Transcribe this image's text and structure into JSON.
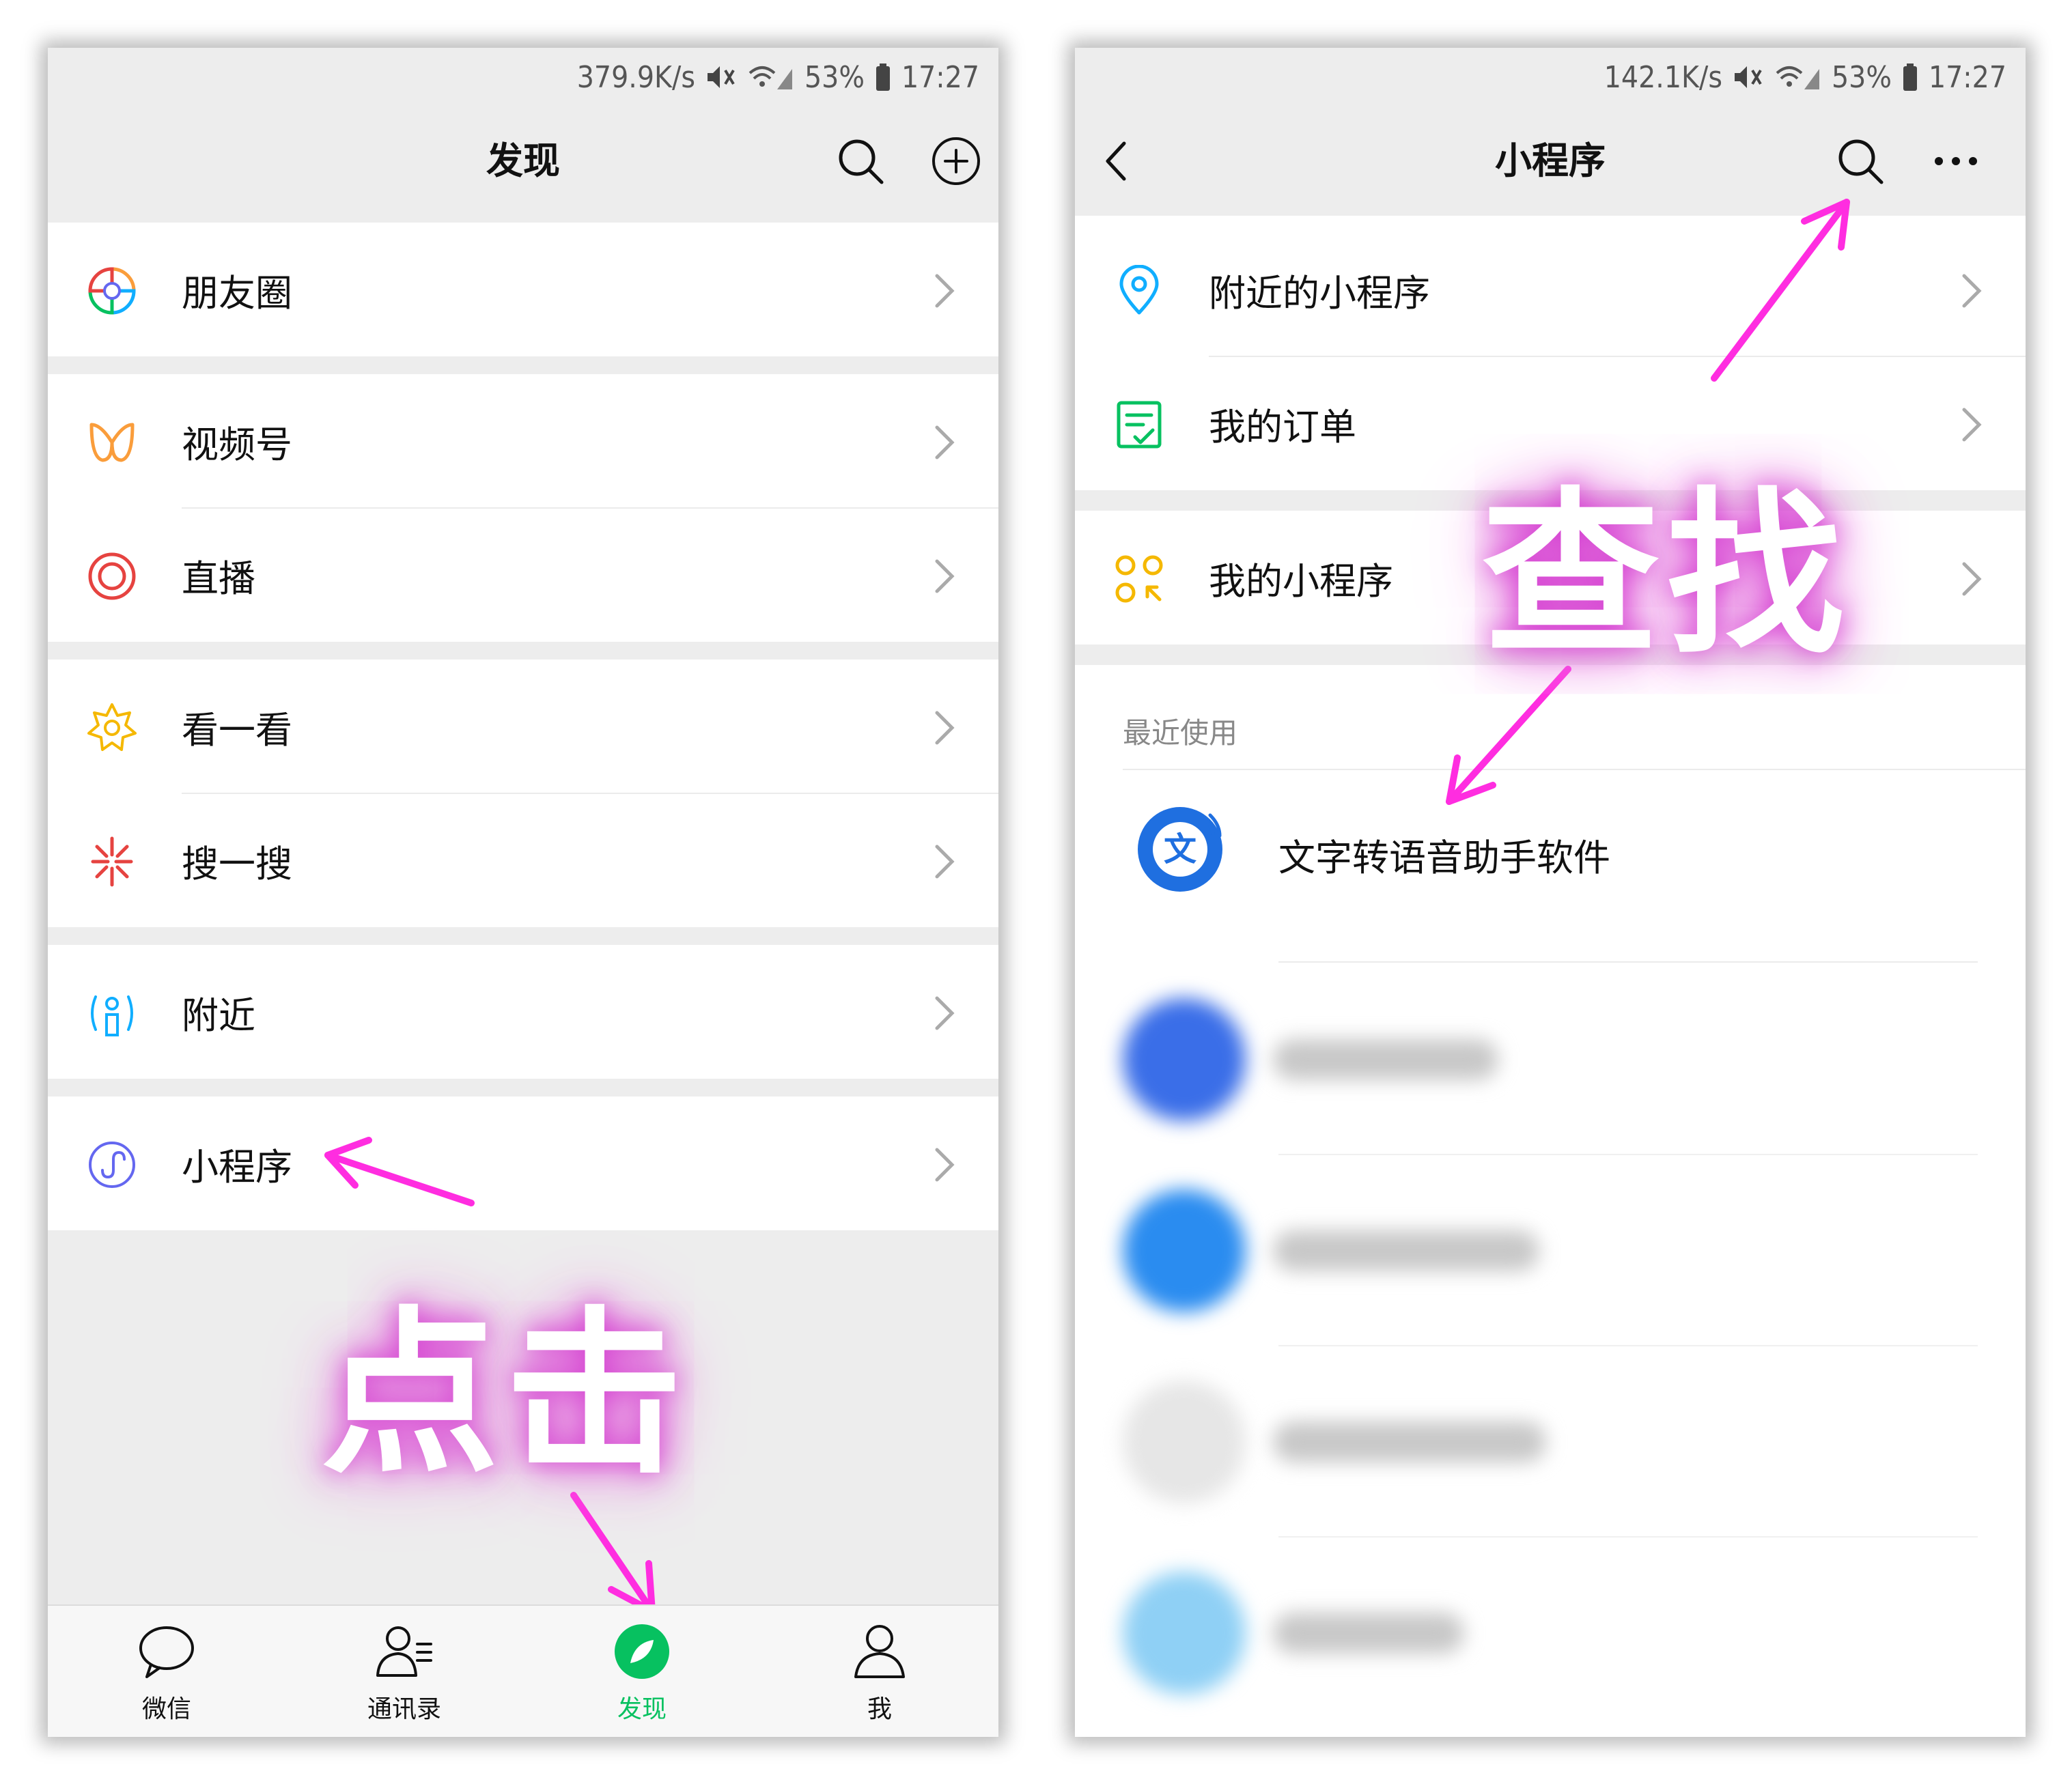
{
  "left_phone": {
    "status": {
      "speed": "379.9K/s",
      "battery": "53%",
      "time": "17:27"
    },
    "nav": {
      "title": "发现",
      "search_icon": "search-icon",
      "add_icon": "plus-circle-icon"
    },
    "items": [
      {
        "label": "朋友圈",
        "icon": "moments-icon"
      },
      {
        "label": "视频号",
        "icon": "channels-icon"
      },
      {
        "label": "直播",
        "icon": "live-icon"
      },
      {
        "label": "看一看",
        "icon": "top-stories-icon"
      },
      {
        "label": "搜一搜",
        "icon": "search-sparkle-icon"
      },
      {
        "label": "附近",
        "icon": "nearby-icon"
      },
      {
        "label": "小程序",
        "icon": "mini-program-icon"
      }
    ],
    "tabs": [
      {
        "label": "微信",
        "icon": "chat-bubble-icon"
      },
      {
        "label": "通讯录",
        "icon": "contacts-icon"
      },
      {
        "label": "发现",
        "icon": "compass-icon"
      },
      {
        "label": "我",
        "icon": "person-icon"
      }
    ],
    "overlay_text": "点击"
  },
  "right_phone": {
    "status": {
      "speed": "142.1K/s",
      "battery": "53%",
      "time": "17:27"
    },
    "nav": {
      "title": "小程序",
      "back_icon": "back-chevron-icon",
      "search_icon": "search-icon",
      "more_icon": "more-dots-icon"
    },
    "items": [
      {
        "label": "附近的小程序",
        "icon": "location-pin-icon"
      },
      {
        "label": "我的订单",
        "icon": "order-list-icon"
      },
      {
        "label": "我的小程序",
        "icon": "my-mini-programs-icon"
      }
    ],
    "recent_label": "最近使用",
    "recent_app": "文字转语音助手软件",
    "overlay_text": "查找"
  },
  "colors": {
    "accent_green": "#07c160",
    "annotation_magenta": "#ff2de0",
    "background_gray": "#ededed"
  }
}
